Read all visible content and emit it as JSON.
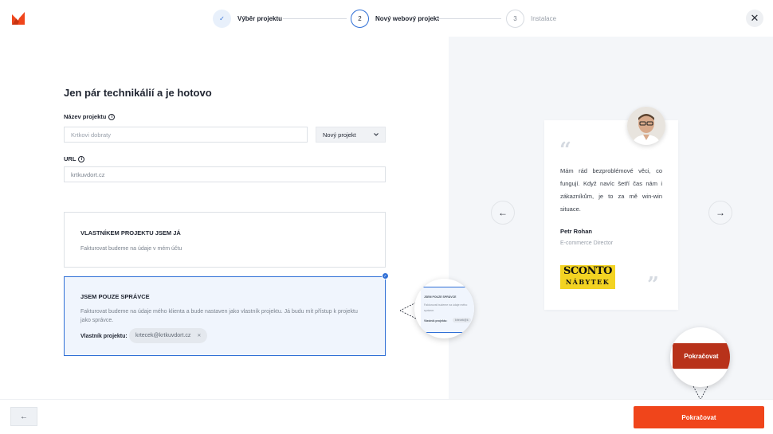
{
  "steps": [
    {
      "number": "✓",
      "label": "Výběr projektu",
      "state": "done"
    },
    {
      "number": "2",
      "label": "Nový webový projekt",
      "state": "active"
    },
    {
      "number": "3",
      "label": "Instalace",
      "state": "pending"
    }
  ],
  "form": {
    "title": "Jen pár technikálií a je hotovo",
    "project_name_label": "Název projektu",
    "project_name_placeholder": "Krtkovi dobraty",
    "project_type_value": "Nový projekt",
    "url_label": "URL",
    "url_value": "krtkuvdort.cz"
  },
  "options": [
    {
      "title": "VLASTNÍKEM PROJEKTU JSEM JÁ",
      "desc": "Fakturovat budeme na údaje v mém účtu"
    },
    {
      "title": "JSEM POUZE SPRÁVCE",
      "desc": "Fakturovat budeme na údaje mého klienta a bude nastaven jako vlastník projektu. Já budu mít přístup k projektu jako správce.",
      "owner_label": "Vlastník projektu:",
      "owner_value": "krtecek@krtkuvdort.cz"
    }
  ],
  "zoom": {
    "title": "JSEM POUZE SPRÁVCE",
    "line1": "Fakturovat budeme na údaje mého",
    "line2": "správce.",
    "owner": "Vlastník projektu:",
    "chip": "krtecek@k"
  },
  "testimonial": {
    "text": "Mám rád bezproblémové věci, co fungují. Když navíc šetří čas nám i zákazníkům, je to za mě win-win situace.",
    "name": "Petr Rohan",
    "role": "E-commerce Director",
    "brand_line1": "SCONTO",
    "brand_line2": "NÁBYTEK"
  },
  "footer": {
    "back": "←",
    "continue": "Pokračovat",
    "continue_zoom": "Pokračovat"
  },
  "icons": {
    "close": "✕",
    "prev": "←",
    "next": "→",
    "chip_remove": "✕"
  },
  "colors": {
    "accent": "#f0451b",
    "selected_border": "#2f6fd6"
  }
}
